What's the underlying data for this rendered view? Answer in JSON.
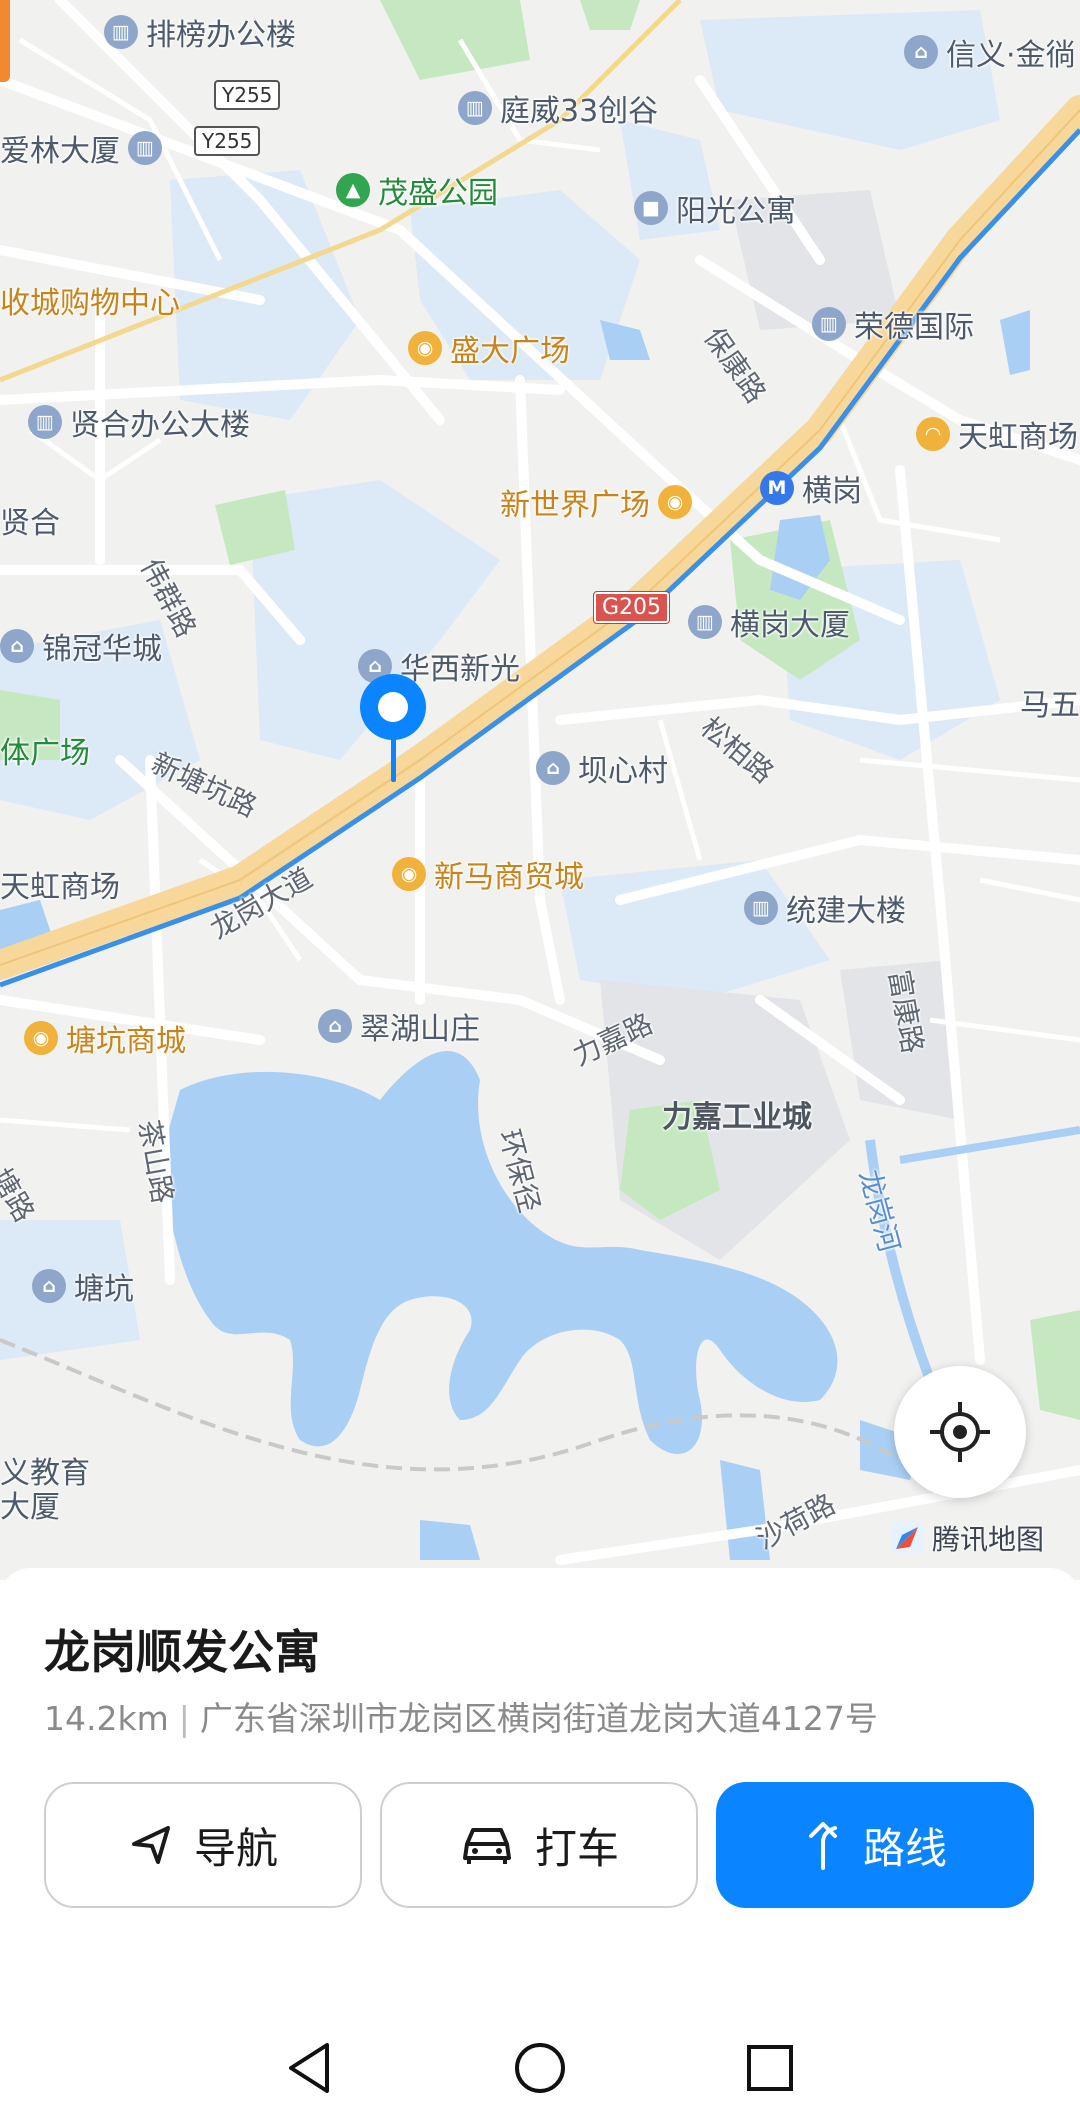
{
  "map": {
    "pois": [
      {
        "name": "排榜办公楼",
        "icon": "office-icon",
        "style": "blue"
      },
      {
        "name": "庭威33创谷",
        "icon": "office-icon",
        "style": "blue"
      },
      {
        "name": "爱林大厦",
        "icon": "office-icon",
        "style": "blue"
      },
      {
        "name": "茂盛公园",
        "icon": "park-icon",
        "style": "green"
      },
      {
        "name": "阳光公寓",
        "icon": "hotel-icon",
        "style": "blue"
      },
      {
        "name": "收城购物中心",
        "icon": "",
        "style": "orange"
      },
      {
        "name": "荣德国际",
        "icon": "office-icon",
        "style": "blue"
      },
      {
        "name": "盛大广场",
        "icon": "shopping-icon",
        "style": "orange"
      },
      {
        "name": "贤合办公大楼",
        "icon": "office-icon",
        "style": "blue"
      },
      {
        "name": "天虹商场",
        "icon": "mall-icon",
        "style": "orange"
      },
      {
        "name": "新世界广场",
        "icon": "shopping-icon",
        "style": "orange"
      },
      {
        "name": "横岗",
        "icon": "metro-icon",
        "style": "metro"
      },
      {
        "name": "贤合",
        "icon": "",
        "style": "plain"
      },
      {
        "name": "横岗大厦",
        "icon": "office-icon",
        "style": "blue"
      },
      {
        "name": "锦冠华城",
        "icon": "residential-icon",
        "style": "blue"
      },
      {
        "name": "华西新光",
        "icon": "residential-icon",
        "style": "blue"
      },
      {
        "name": "马五",
        "icon": "",
        "style": "plain"
      },
      {
        "name": "坝心村",
        "icon": "residential-icon",
        "style": "blue"
      },
      {
        "name": "体广场",
        "icon": "",
        "style": "green"
      },
      {
        "name": "新马商贸城",
        "icon": "shopping-icon",
        "style": "orange"
      },
      {
        "name": "统建大楼",
        "icon": "office-icon",
        "style": "blue"
      },
      {
        "name": "天虹商场",
        "icon": "",
        "style": "plain"
      },
      {
        "name": "塘坑商城",
        "icon": "shopping-icon",
        "style": "orange"
      },
      {
        "name": "翠湖山庄",
        "icon": "residential-icon",
        "style": "blue"
      },
      {
        "name": "力嘉工业城",
        "icon": "",
        "style": "bold"
      },
      {
        "name": "塘坑",
        "icon": "residential-icon",
        "style": "blue"
      },
      {
        "name": "义教育",
        "icon": "",
        "style": "plain"
      },
      {
        "name": "大厦",
        "icon": "",
        "style": "plain"
      },
      {
        "name": "信义·金徜",
        "icon": "residential-icon",
        "style": "blue"
      }
    ],
    "roads": [
      "伟群路",
      "保康路",
      "新塘坑路",
      "松柏路",
      "龙岗大道",
      "力嘉路",
      "富康路",
      "茶山路",
      "环保径",
      "龙岗河",
      "沙荷路",
      "塘路"
    ],
    "shields": [
      "Y255",
      "Y255",
      "G205"
    ],
    "watermark": "腾讯地图",
    "locate_icon": "locate-icon",
    "pin_icon": "location-pin-icon"
  },
  "place": {
    "name": "龙岗顺发公寓",
    "distance": "14.2km",
    "separator": "|",
    "address": "广东省深圳市龙岗区横岗街道龙岗大道4127号"
  },
  "actions": {
    "navigate": {
      "label": "导航",
      "icon": "navigate-arrow-icon"
    },
    "taxi": {
      "label": "打车",
      "icon": "car-icon"
    },
    "route": {
      "label": "路线",
      "icon": "route-turn-icon"
    }
  },
  "colors": {
    "primary": "#0a84ff",
    "water": "#a9cff5",
    "park": "#c6e8c1",
    "expressway": "#f7d79a",
    "route": "#3a8fe6"
  },
  "navbar": {
    "back": "back-icon",
    "home": "home-icon",
    "recents": "recents-icon"
  }
}
